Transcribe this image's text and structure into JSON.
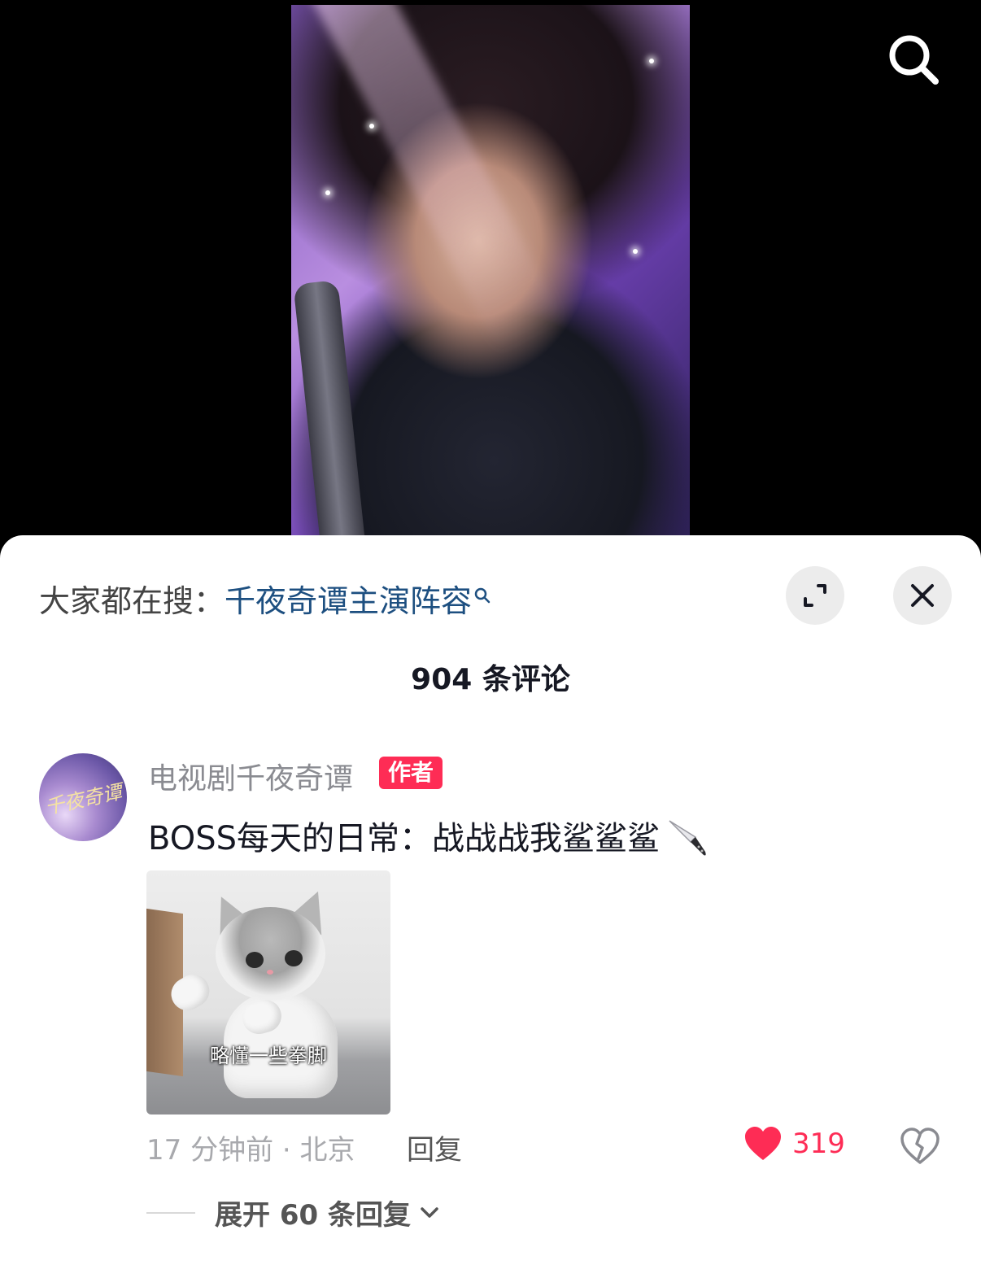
{
  "video": {
    "search_icon": "search-icon"
  },
  "sheet": {
    "hot_search_prefix": "大家都在搜：",
    "hot_search_term": "千夜奇谭主演阵容",
    "expand_icon": "expand-icon",
    "close_icon": "close-icon",
    "comment_count_title": "904 条评论"
  },
  "comment": {
    "avatar_text": "千夜奇谭",
    "username": "电视剧千夜奇谭",
    "badge": "作者",
    "text": "BOSS每天的日常：战战战我鲨鲨鲨",
    "sticker_caption": "略懂一些拳脚",
    "time_location": "17 分钟前 · 北京",
    "reply_label": "回复",
    "like_count": "319",
    "expand_replies": "展开 60 条回复"
  },
  "colors": {
    "accent": "#fe2c55",
    "link": "#1d4f80",
    "text_primary": "#161823",
    "text_secondary": "#8a8b91"
  }
}
